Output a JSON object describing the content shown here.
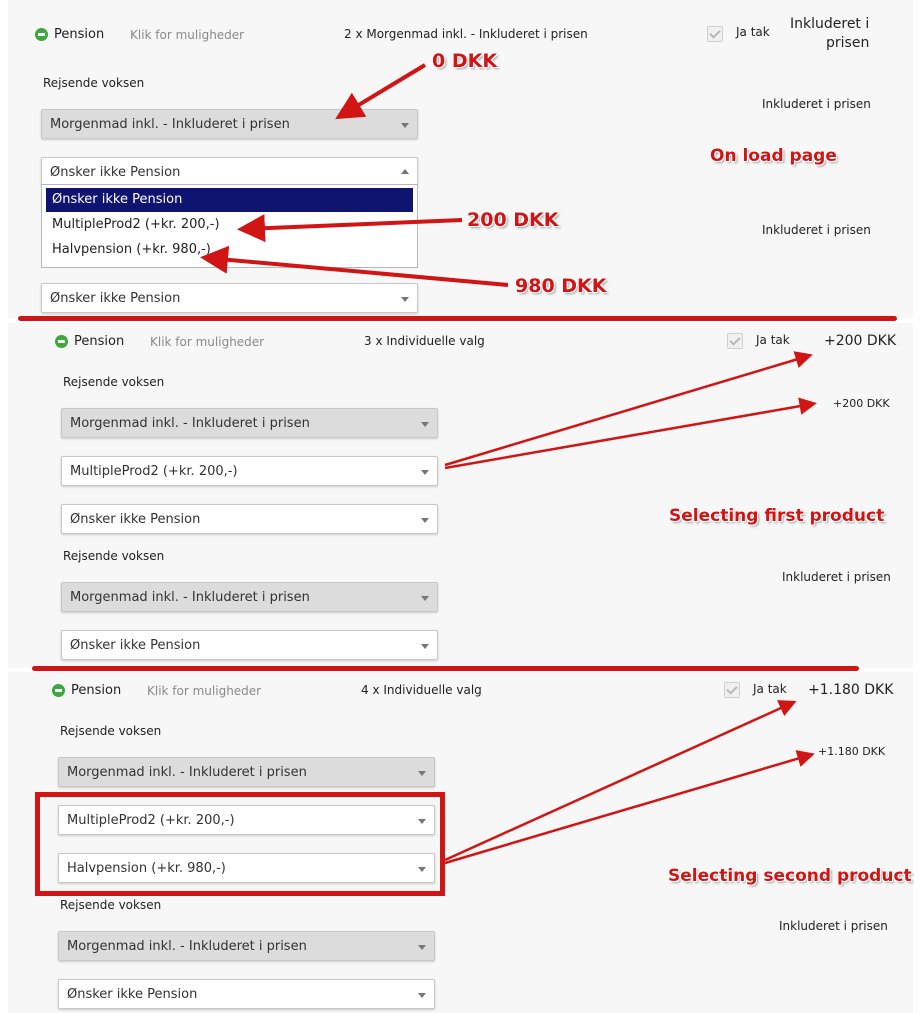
{
  "sections": [
    {
      "pension_label": "Pension",
      "options_link": "Klik for muligheder",
      "summary": "2 x Morgenmad inkl. - Inkluderet i prisen",
      "ja_tak": "Ja tak",
      "price_line1": "Inkluderet i",
      "price_line2": "prisen",
      "travelers": [
        {
          "label": "Rejsende voksen",
          "price": "Inkluderet i prisen",
          "select1": "Morgenmad inkl. - Inkluderet i prisen",
          "select2": "Ønsker ikke Pension",
          "dropdown_options": [
            "Ønsker ikke Pension",
            "MultipleProd2 (+kr. 200,-)",
            "Halvpension (+kr. 980,-)"
          ],
          "row_price": "Inkluderet i prisen",
          "select3": "Ønsker ikke Pension"
        }
      ]
    },
    {
      "pension_label": "Pension",
      "options_link": "Klik for muligheder",
      "summary": "3 x Individuelle valg",
      "ja_tak": "Ja tak",
      "price": "+200 DKK",
      "travelers": [
        {
          "label": "Rejsende voksen",
          "price": "+200 DKK",
          "select1": "Morgenmad inkl. - Inkluderet i prisen",
          "select2": "MultipleProd2 (+kr. 200,-)",
          "select3": "Ønsker ikke Pension"
        },
        {
          "label": "Rejsende voksen",
          "price": "Inkluderet i prisen",
          "select1": "Morgenmad inkl. - Inkluderet i prisen",
          "select2": "Ønsker ikke Pension"
        }
      ]
    },
    {
      "pension_label": "Pension",
      "options_link": "Klik for muligheder",
      "summary": "4 x Individuelle valg",
      "ja_tak": "Ja tak",
      "price": "+1.180 DKK",
      "travelers": [
        {
          "label": "Rejsende voksen",
          "price": "+1.180 DKK",
          "select1": "Morgenmad inkl. - Inkluderet i prisen",
          "select2": "MultipleProd2 (+kr. 200,-)",
          "select3": "Halvpension (+kr. 980,-)"
        },
        {
          "label": "Rejsende voksen",
          "price": "Inkluderet i prisen",
          "select1": "Morgenmad inkl. - Inkluderet i prisen",
          "select2": "Ønsker ikke Pension"
        }
      ]
    }
  ],
  "annotations": {
    "zero": "0 DKK",
    "two_hundred": "200 DKK",
    "nine_eighty": "980 DKK",
    "on_load": "On load page",
    "first_product": "Selecting first product",
    "second_product": "Selecting second product"
  },
  "colors": {
    "annotation_red": "#d11414",
    "highlight_navy": "#0f1470",
    "pension_icon_green": "#3aa83a"
  },
  "icons": {
    "pension_toggle": "minus-circle-icon",
    "accept_checkbox": "checkmark-icon",
    "select_caret": "chevron-down-icon"
  }
}
